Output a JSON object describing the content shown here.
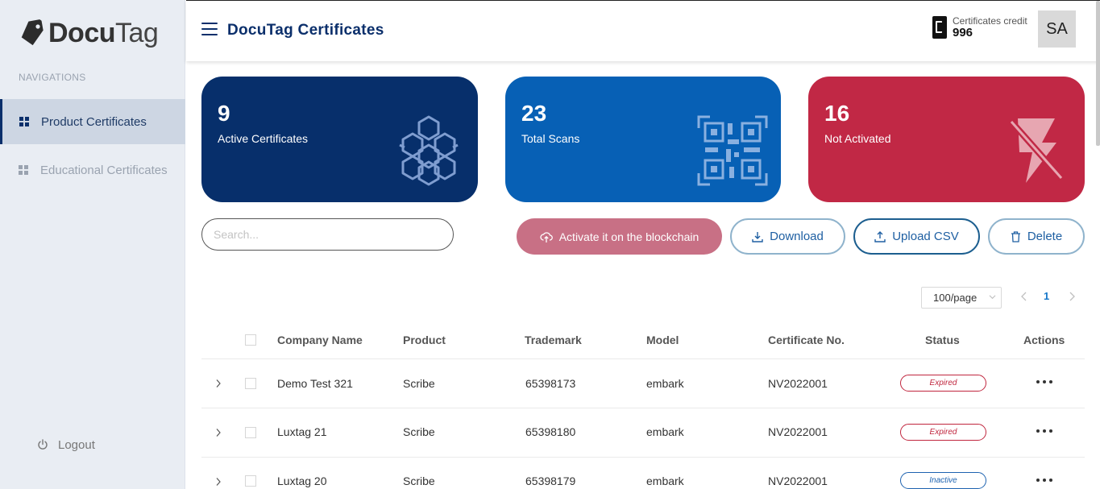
{
  "brand": {
    "name_bold": "Docu",
    "name_light": "Tag"
  },
  "sidebar": {
    "caption": "NAVIGATIONS",
    "items": [
      {
        "label": "Product Certificates",
        "active": true
      },
      {
        "label": "Educational Certificates",
        "active": false
      }
    ],
    "logout": "Logout"
  },
  "header": {
    "title": "DocuTag Certificates",
    "credit_label": "Certificates credit",
    "credit_value": "996",
    "avatar": "SA"
  },
  "stats": [
    {
      "value": "9",
      "label": "Active Certificates",
      "color": "#072f6b",
      "icon": "cubes-network-icon"
    },
    {
      "value": "23",
      "label": "Total Scans",
      "color": "#0760b5",
      "icon": "qr-code-icon"
    },
    {
      "value": "16",
      "label": "Not Activated",
      "color": "#c12845",
      "icon": "lightning-off-icon"
    }
  ],
  "toolbar": {
    "search_placeholder": "Search...",
    "activate_label": "Activate it on the blockchain",
    "download_label": "Download",
    "upload_label": "Upload CSV",
    "delete_label": "Delete"
  },
  "pagination": {
    "page_size": "100/page",
    "current_page": "1"
  },
  "table": {
    "columns": [
      "Company Name",
      "Product",
      "Trademark",
      "Model",
      "Certificate No.",
      "Status",
      "Actions"
    ],
    "rows": [
      {
        "company": "Demo Test 321",
        "product": "Scribe",
        "trademark": "65398173",
        "model": "embark",
        "certificate": "NV2022001",
        "status": "Expired"
      },
      {
        "company": "Luxtag 21",
        "product": "Scribe",
        "trademark": "65398180",
        "model": "embark",
        "certificate": "NV2022001",
        "status": "Expired"
      },
      {
        "company": "Luxtag 20",
        "product": "Scribe",
        "trademark": "65398179",
        "model": "embark",
        "certificate": "NV2022001",
        "status": "Inactive"
      }
    ]
  }
}
